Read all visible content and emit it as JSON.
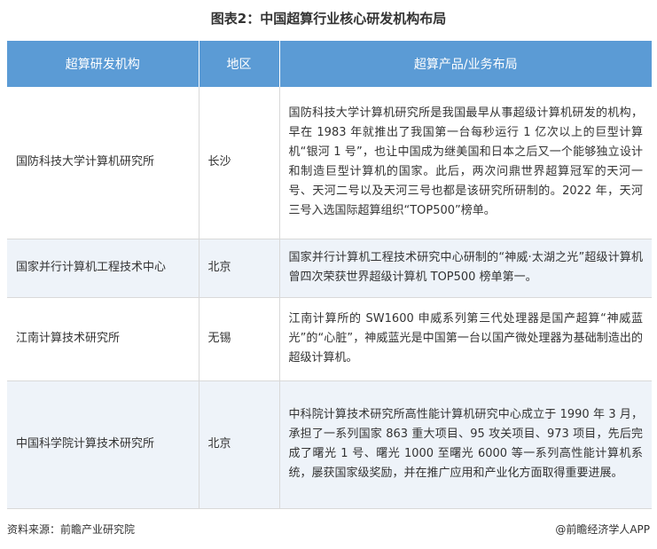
{
  "title": "图表2：中国超算行业核心研发机构布局",
  "table": {
    "headers": [
      "超算研发机构",
      "地区",
      "超算产品/业务布局"
    ],
    "rows": [
      {
        "org": "国防科技大学计算机研究所",
        "region": "长沙",
        "desc": "国防科技大学计算机研究所是我国最早从事超级计算机研发的机构，早在 1983 年就推出了我国第一台每秒运行 1 亿次以上的巨型计算机“银河 1 号”，也让中国成为继美国和日本之后又一个能够独立设计和制造巨型计算机的国家。此后，两次问鼎世界超算冠军的天河一号、天河二号以及天河三号也都是该研究所研制的。2022 年，天河三号入选国际超算组织“TOP500”榜单。"
      },
      {
        "org": "国家并行计算机工程技术中心",
        "region": "北京",
        "desc": "国家并行计算机工程技术研究中心研制的“神威·太湖之光”超级计算机曾四次荣获世界超级计算机 TOP500 榜单第一。"
      },
      {
        "org": "江南计算技术研究所",
        "region": "无锡",
        "desc": "江南计算所的 SW1600 申威系列第三代处理器是国产超算“神威蓝光”的“心脏”，神威蓝光是中国第一台以国产微处理器为基础制造出的超级计算机。"
      },
      {
        "org": "中国科学院计算技术研究所",
        "region": "北京",
        "desc": "中科院计算技术研究所高性能计算机研究中心成立于 1990 年 3 月，承担了一系列国家 863 重大项目、95 攻关项目、973 项目，先后完成了曙光 1 号、曙光 1000 至曙光 6000 等一系列高性能计算机系统，屡获国家级奖励，并在推广应用和产业化方面取得重要进展。"
      }
    ]
  },
  "footer": {
    "source": "资料来源：前瞻产业研究院",
    "brand": "@前瞻经济学人APP"
  }
}
